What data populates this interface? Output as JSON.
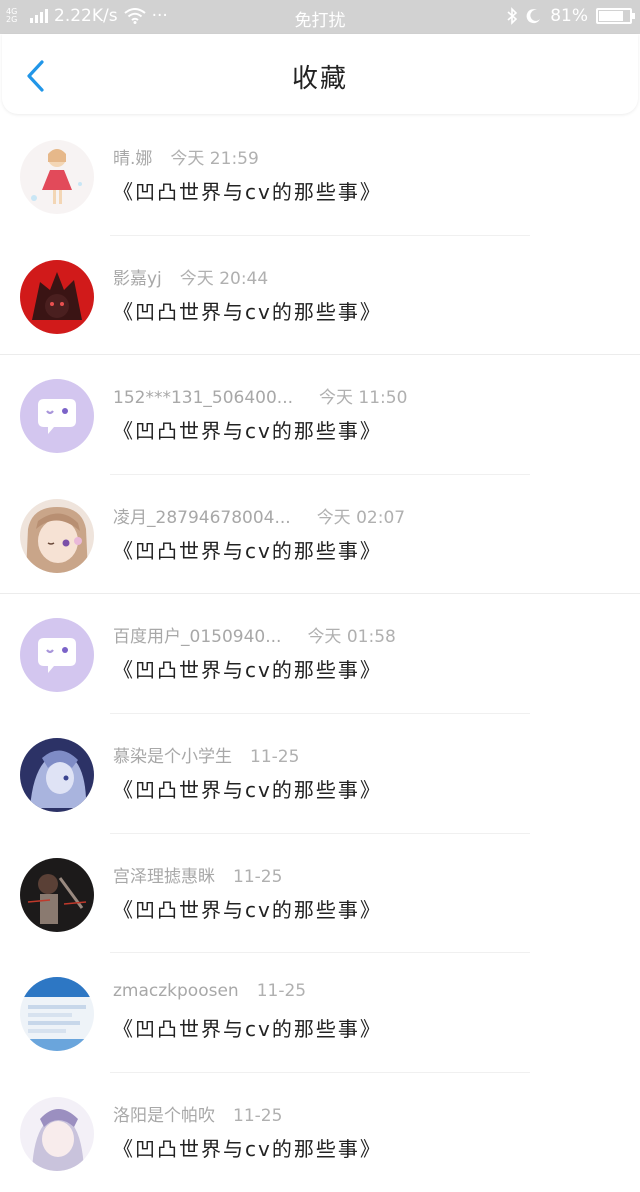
{
  "status": {
    "net_top": "4G",
    "net_bottom": "2G",
    "speed": "2.22K/s",
    "more": "···",
    "mode": "免打扰",
    "battery": "81%",
    "battery_level": 0.81
  },
  "header": {
    "title": "收藏"
  },
  "items": [
    {
      "user": "晴.娜",
      "time": "今天 21:59",
      "title": "《凹凸世界与cv的那些事》"
    },
    {
      "user": "影嘉yj",
      "time": "今天 20:44",
      "title": "《凹凸世界与cv的那些事》"
    },
    {
      "user": "152***131_506400...",
      "time": "今天 11:50",
      "title": "《凹凸世界与cv的那些事》"
    },
    {
      "user": "凌月_28794678004...",
      "time": "今天 02:07",
      "title": "《凹凸世界与cv的那些事》"
    },
    {
      "user": "百度用户_0150940...",
      "time": "今天 01:58",
      "title": "《凹凸世界与cv的那些事》"
    },
    {
      "user": "慕染是个小学生",
      "time": "11-25",
      "title": "《凹凸世界与cv的那些事》"
    },
    {
      "user": "宫泽理摅惠眯",
      "time": "11-25",
      "title": "《凹凸世界与cv的那些事》"
    },
    {
      "user": "zmaczkpoosen",
      "time": "11-25",
      "title": "《凹凸世界与cv的那些事》"
    },
    {
      "user": "洛阳是个帕吹",
      "time": "11-25",
      "title": "《凹凸世界与cv的那些事》"
    }
  ]
}
